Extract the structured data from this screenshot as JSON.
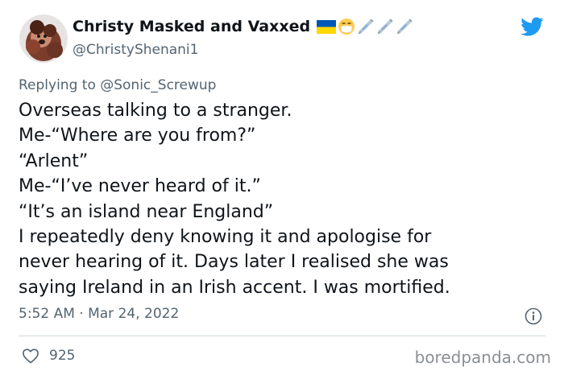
{
  "tweet": {
    "display_name": "Christy Masked and Vaxxed",
    "handle": "@ChristyShenani1",
    "name_emojis": [
      "ukraine-flag-emoji",
      "face-with-mask-emoji",
      "syringe-emoji",
      "syringe-emoji",
      "syringe-emoji"
    ],
    "replying_to": "Replying to @Sonic_Screwup",
    "body_lines": [
      "Overseas talking to a stranger.",
      "Me-“Where are you from?”",
      "“Arlent”",
      "Me-“I’ve never heard of it.”",
      "“It’s an island near England”",
      "I repeatedly deny knowing it and apologise for",
      "never hearing of it. Days later I realised she was",
      "saying Ireland in an Irish accent. I was mortified."
    ],
    "timestamp": "5:52 AM · Mar 24, 2022",
    "like_count": "925"
  },
  "watermark": "boredpanda.com",
  "colors": {
    "twitter_blue": "#1d9bf0",
    "secondary_text": "#536471",
    "primary_text": "#0f1419",
    "ukraine_blue": "#0057b7",
    "ukraine_yellow": "#ffd700"
  },
  "icons": {
    "brand": "twitter-bird-icon",
    "info": "info-icon",
    "like": "heart-icon"
  }
}
